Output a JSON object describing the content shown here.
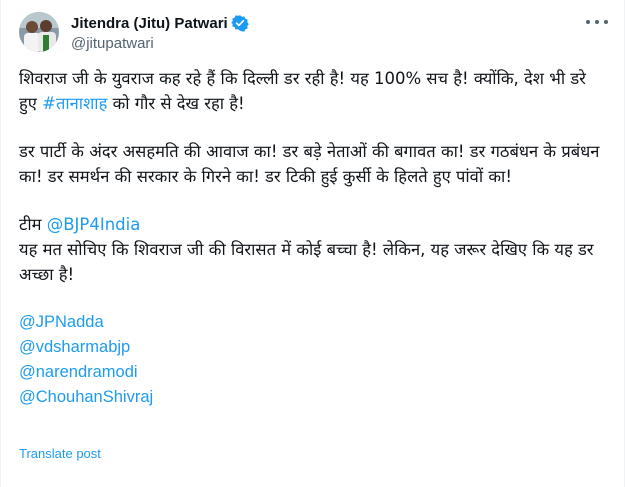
{
  "author": {
    "display_name": "Jitendra (Jitu) Patwari",
    "handle": "@jitupatwari",
    "verified_icon": "verified-badge-icon",
    "colors": {
      "verified": "#1d9bf0"
    }
  },
  "tweet": {
    "p1_text_a": "शिवराज जी के युवराज कह रहे हैं कि दिल्ली डर रही है! यह 100% सच है! क्योंकि, देश भी डरे हुए ",
    "p1_hashtag": "#तानाशाह",
    "p1_text_b": " को गौर से देख रहा है!",
    "p2_text": "डर पार्टी के अंदर असहमति की आवाज का! डर बड़े नेताओं की बगावत का! डर गठबंधन के प्रबंधन का! डर समर्थन की सरकार के गिरने का! डर टिकी हुई कुर्सी के हिलते हुए पांवों का!",
    "p3_text_a": "टीम ",
    "p3_mention": "@BJP4India",
    "p3_text_b": "यह मत सोचिए कि शिवराज जी की विरासत में कोई बच्चा है! लेकिन, यह जरूर देखिए कि यह डर अच्छा है!",
    "mentions": [
      "@JPNadda",
      "@vdsharmabjp",
      "@narendramodi",
      "@ChouhanShivraj"
    ]
  },
  "actions": {
    "translate_label": "Translate post",
    "more_icon": "more-options-icon"
  },
  "colors": {
    "link": "#1d9bf0",
    "text": "#0f1419",
    "secondary": "#536471"
  }
}
